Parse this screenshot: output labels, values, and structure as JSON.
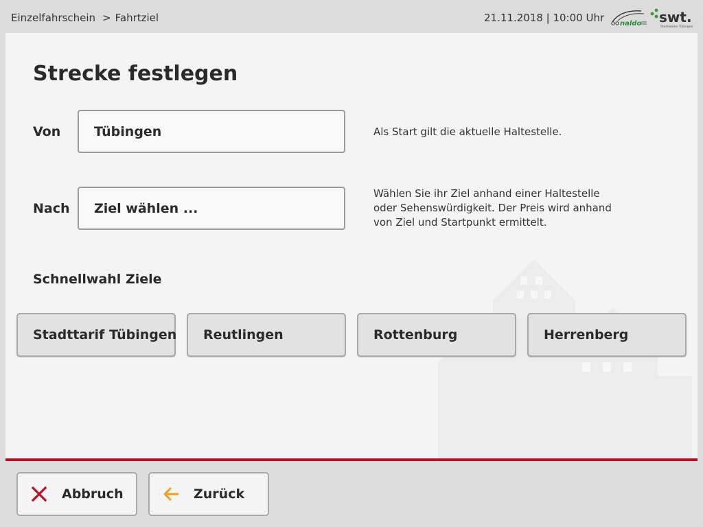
{
  "header": {
    "breadcrumb": [
      {
        "label": "Einzelfahrschein"
      },
      {
        "label": "Fahrtziel"
      }
    ],
    "breadcrumb_separator": ">",
    "datetime": "21.11.2018 | 10:00 Uhr",
    "logos": {
      "naldo": {
        "text": "naldo",
        "icon": "naldo-logo",
        "color": "#2c8a3c"
      },
      "swt": {
        "text": "swt.",
        "subtext": "Stadtwerke Tübingen",
        "icon": "swt-logo",
        "color": "#3a9a3a"
      }
    }
  },
  "main": {
    "title": "Strecke festlegen",
    "from": {
      "label": "Von",
      "value": "Tübingen",
      "hint": "Als Start gilt die aktuelle Haltestelle."
    },
    "to": {
      "label": "Nach",
      "value": "Ziel wählen ...",
      "hint": "Wählen Sie ihr Ziel anhand einer Haltestelle oder Sehenswürdigkeit. Der Preis wird anhand von Ziel und Startpunkt ermittelt."
    },
    "quick_select": {
      "label": "Schnellwahl Ziele",
      "options": [
        {
          "label": "Stadttarif Tübingen"
        },
        {
          "label": "Reutlingen"
        },
        {
          "label": "Rottenburg"
        },
        {
          "label": "Herrenberg"
        }
      ]
    }
  },
  "footer": {
    "cancel": {
      "label": "Abbruch",
      "icon": "close-icon",
      "color": "#b5122a"
    },
    "back": {
      "label": "Zurück",
      "icon": "arrow-left-icon",
      "color": "#f0a020"
    }
  },
  "colors": {
    "accent": "#b5122a",
    "panel": "#f4f4f4",
    "background": "#dcdcdc"
  }
}
